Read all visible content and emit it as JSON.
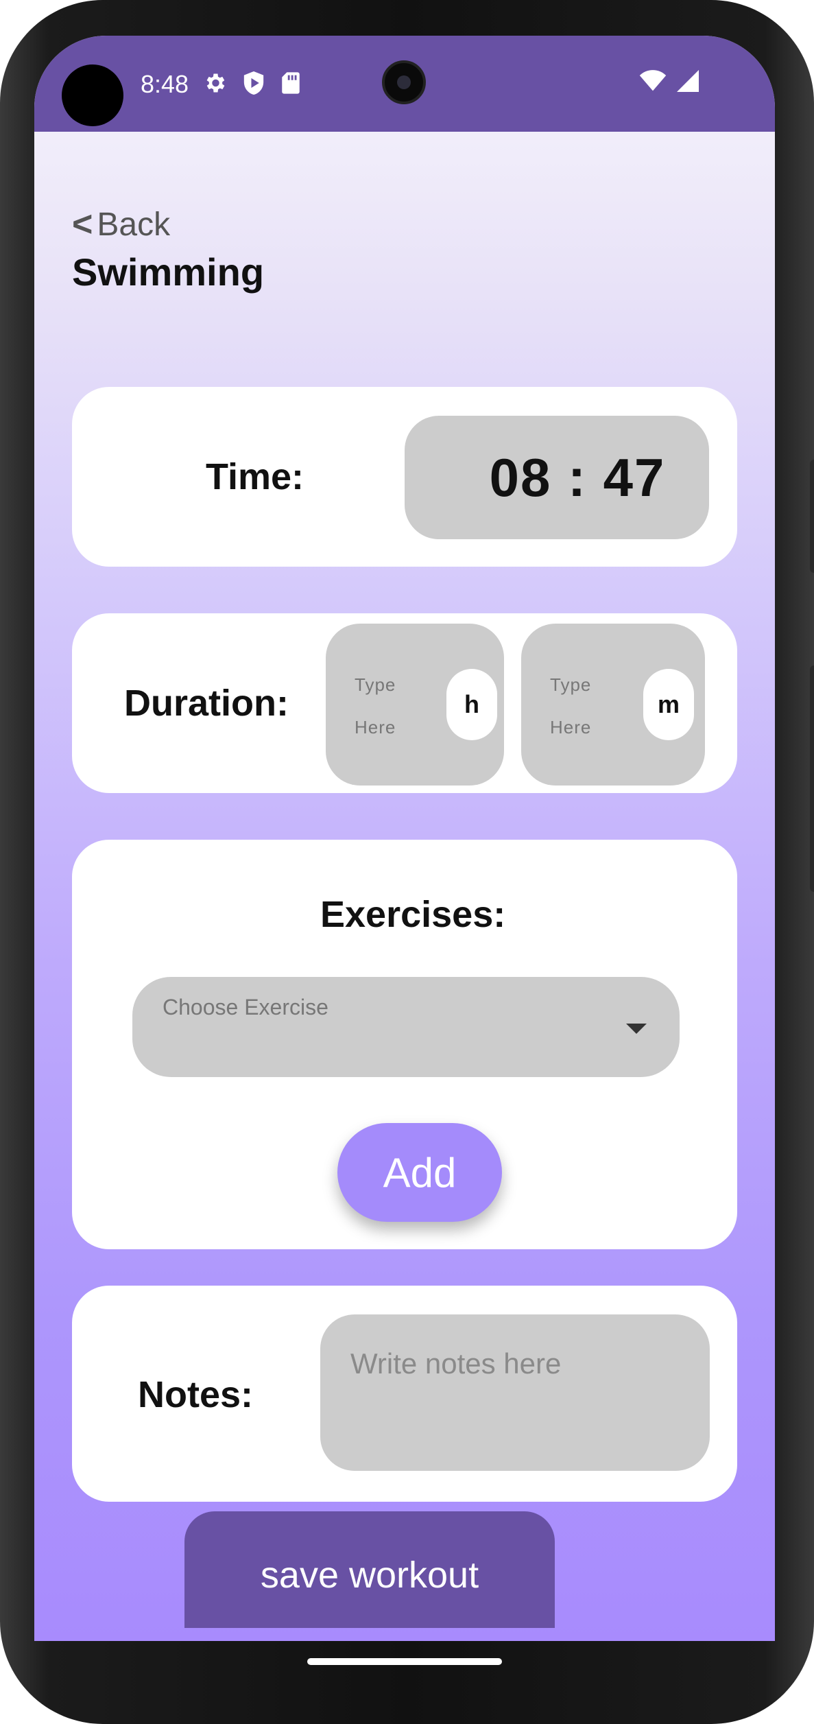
{
  "status_bar": {
    "time": "8:48",
    "icons": [
      "gear-icon",
      "shield-play-icon",
      "sd-card-icon",
      "wifi-icon",
      "cell-signal-icon"
    ],
    "background_color": "#6851a4"
  },
  "header": {
    "back_chevron": "<",
    "back_label": "Back",
    "title": "Swimming"
  },
  "time_card": {
    "label": "Time:",
    "value": "08 : 47"
  },
  "duration_card": {
    "label": "Duration:",
    "hours_placeholder_line1": "Type",
    "hours_placeholder_line2": "Here",
    "hours_unit": "h",
    "minutes_placeholder_line1": "Type",
    "minutes_placeholder_line2": "Here",
    "minutes_unit": "m"
  },
  "exercises_card": {
    "label": "Exercises:",
    "select_placeholder": "Choose Exercise",
    "add_label": "Add"
  },
  "notes_card": {
    "label": "Notes:",
    "placeholder": "Write notes here"
  },
  "save_label": "save workout",
  "colors": {
    "accent": "#a48bfb",
    "primary": "#6851a4",
    "field_bg": "#cccccc"
  }
}
